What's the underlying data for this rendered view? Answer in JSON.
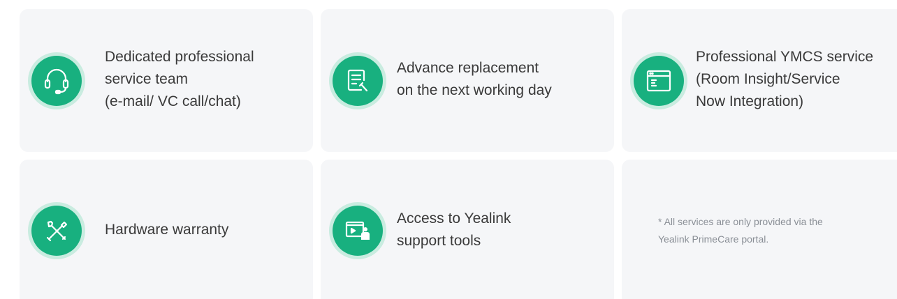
{
  "colors": {
    "card_background": "#f5f6f8",
    "icon_ring": "#c9ece0",
    "icon_fill": "#18b07f",
    "text": "#3a3a3a",
    "note_text": "#8a8f96"
  },
  "services": [
    {
      "icon": "headset-icon",
      "label": "Dedicated professional\nservice team\n(e-mail/ VC call/chat)"
    },
    {
      "icon": "document-replace-icon",
      "label": "Advance replacement\non the next working day"
    },
    {
      "icon": "window-dashboard-icon",
      "label": "Professional YMCS service\n(Room Insight/Service\nNow Integration)"
    },
    {
      "icon": "tools-icon",
      "label": "Hardware warranty"
    },
    {
      "icon": "presentation-support-icon",
      "label": "Access to Yealink\nsupport tools"
    }
  ],
  "note": "* All services are only provided via the\n  Yealink PrimeCare portal."
}
